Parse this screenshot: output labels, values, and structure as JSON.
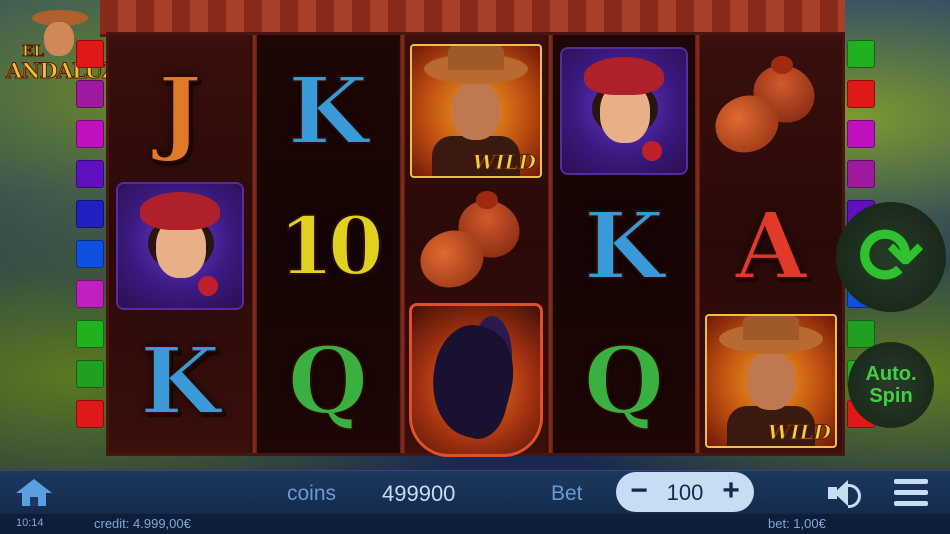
{
  "game": {
    "logo_small": "EL",
    "logo_title": "ANDALUZ"
  },
  "reels": [
    [
      "J",
      "lady",
      "K"
    ],
    [
      "K",
      "10",
      "Q"
    ],
    [
      "wild",
      "castanets",
      "horse"
    ],
    [
      "lady",
      "K",
      "Q"
    ],
    [
      "castanets",
      "A",
      "wild"
    ]
  ],
  "symbol_labels": {
    "wild": "WILD"
  },
  "paylines": {
    "left_colors": [
      "#e01818",
      "#a01aa0",
      "#c010c0",
      "#6010c0",
      "#2020c0",
      "#1050e0",
      "#c020c0",
      "#20b020",
      "#20a020",
      "#e01818"
    ],
    "right_colors": [
      "#20b020",
      "#e01818",
      "#c010c0",
      "#a01aa0",
      "#6010c0",
      "#2020c0",
      "#1050e0",
      "#20a020",
      "#20b020",
      "#e01818"
    ]
  },
  "controls": {
    "spin_icon": "refresh-icon",
    "auto_spin_line1": "Auto.",
    "auto_spin_line2": "Spin"
  },
  "bottombar": {
    "coins_label": "coins",
    "coins_value": "499900",
    "bet_label": "Bet",
    "bet_value": "100",
    "bet_minus": "−",
    "bet_plus": "+"
  },
  "statusbar": {
    "time": "10:14",
    "credit": "credit: 4.999,00€",
    "bet": "bet: 1,00€"
  },
  "colors": {
    "accent_green": "#30c030",
    "bar_blue": "#1c3860",
    "text_light": "#c8dcf4"
  }
}
